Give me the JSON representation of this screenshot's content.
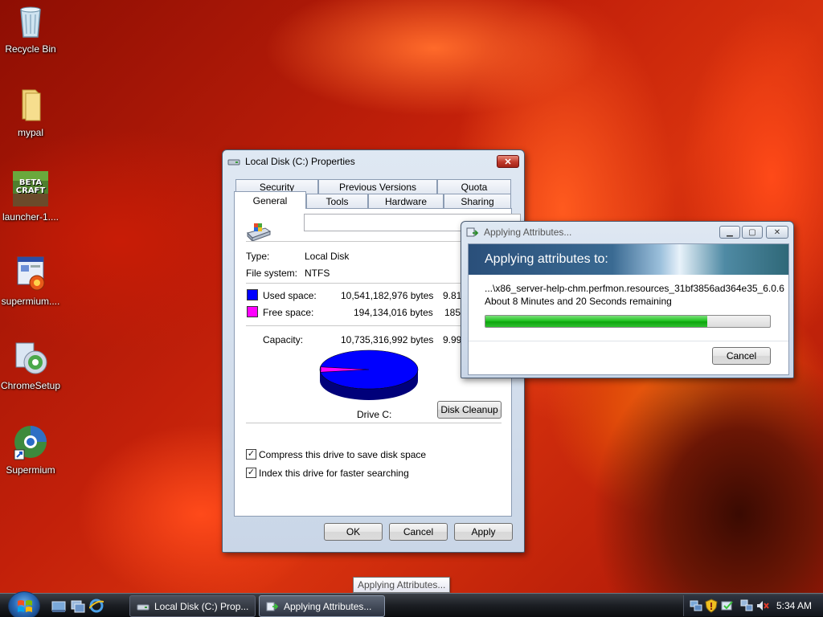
{
  "desktop": {
    "icons": [
      {
        "label": "Recycle Bin"
      },
      {
        "label": "mypal"
      },
      {
        "label": "launcher-1...."
      },
      {
        "label": "supermium...."
      },
      {
        "label": "ChromeSetup"
      },
      {
        "label": "Supermium"
      }
    ],
    "launcher_badge_text": "BETA CRAFT"
  },
  "properties_dialog": {
    "title": "Local Disk (C:) Properties",
    "tabs_row1": [
      "Security",
      "Previous Versions",
      "Quota"
    ],
    "tabs_row2": [
      "General",
      "Tools",
      "Hardware",
      "Sharing"
    ],
    "active_tab": "General",
    "volume_label_value": "",
    "type_label": "Type:",
    "type_value": "Local Disk",
    "fs_label": "File system:",
    "fs_value": "NTFS",
    "used_label": "Used space:",
    "used_bytes": "10,541,182,976 bytes",
    "used_short": "9.81",
    "free_label": "Free space:",
    "free_bytes": "194,134,016 bytes",
    "free_short": "185",
    "capacity_label": "Capacity:",
    "capacity_bytes": "10,735,316,992 bytes",
    "capacity_short": "9.99",
    "drive_label": "Drive C:",
    "disk_cleanup_label": "Disk Cleanup",
    "compress_label": "Compress this drive to save disk space",
    "compress_checked": true,
    "index_label": "Index this drive for faster searching",
    "index_checked": true,
    "ok_label": "OK",
    "cancel_label": "Cancel",
    "apply_label": "Apply",
    "colors": {
      "used": "#0000ff",
      "free": "#ff00ff"
    },
    "used_fraction": 0.982
  },
  "attributes_dialog": {
    "title": "Applying Attributes...",
    "header": "Applying attributes to:",
    "file_path": "...\\x86_server-help-chm.perfmon.resources_31bf3856ad364e35_6.0.6",
    "time_remaining": "About 8 Minutes and 20 Seconds remaining",
    "progress": 0.78,
    "cancel_label": "Cancel"
  },
  "tooltip": "Applying Attributes...",
  "taskbar": {
    "buttons": [
      {
        "label": "Local Disk (C:) Prop..."
      },
      {
        "label": "Applying Attributes..."
      }
    ],
    "clock": "5:34 AM"
  }
}
